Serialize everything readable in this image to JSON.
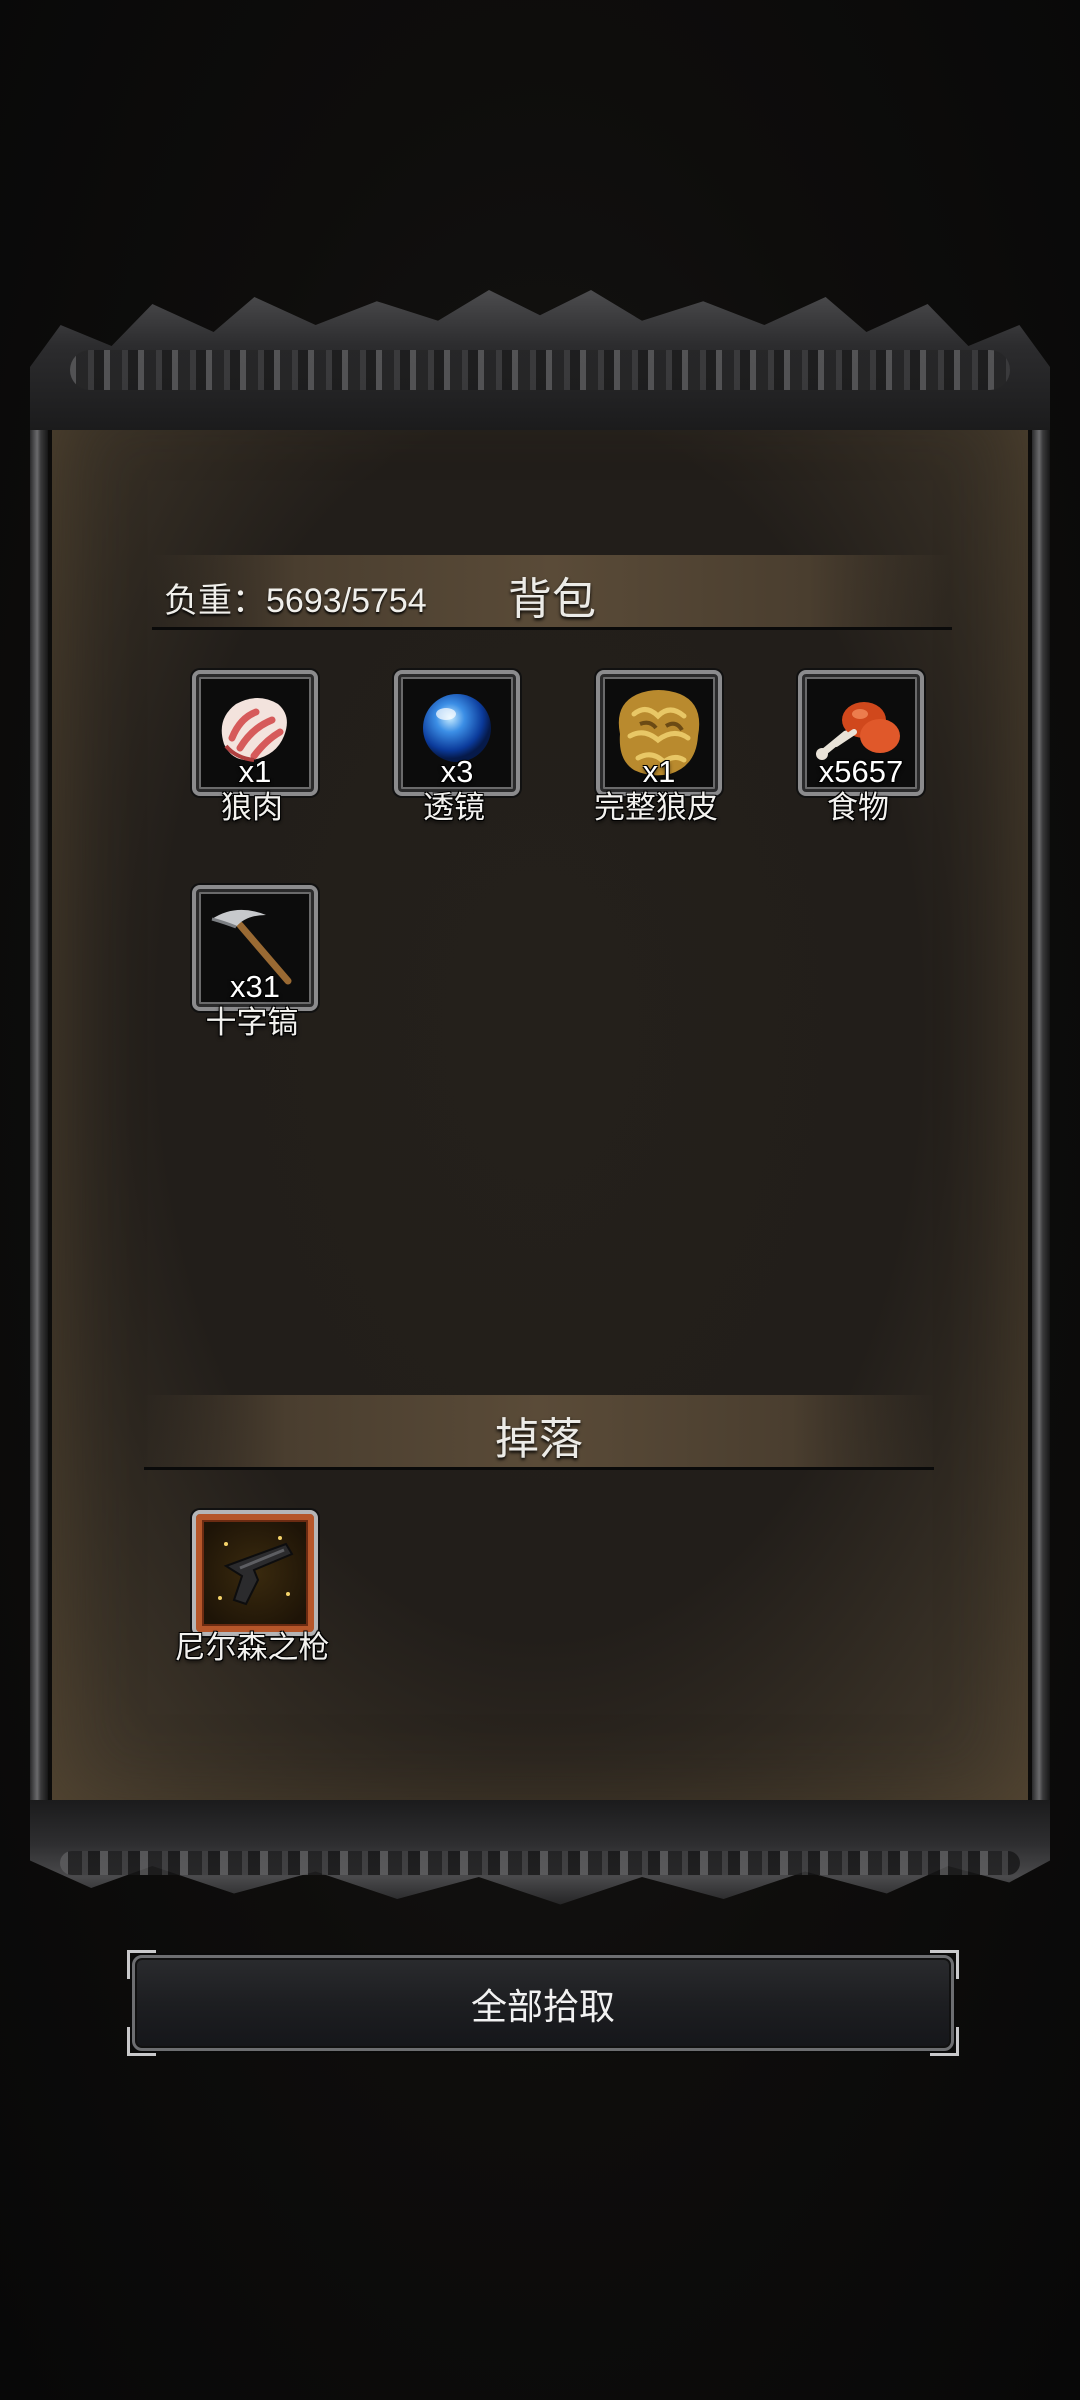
{
  "inventory": {
    "title": "背包",
    "weight_text": "负重：5693/5754",
    "items": [
      {
        "name": "狼肉",
        "count": "x1",
        "icon": "wolf-meat-icon"
      },
      {
        "name": "透镜",
        "count": "x3",
        "icon": "lens-icon"
      },
      {
        "name": "完整狼皮",
        "count": "x1",
        "icon": "wolf-pelt-icon"
      },
      {
        "name": "食物",
        "count": "x5657",
        "icon": "food-drumstick-icon"
      },
      {
        "name": "十字镐",
        "count": "x31",
        "icon": "pickaxe-icon"
      }
    ]
  },
  "drops": {
    "title": "掉落",
    "items": [
      {
        "name": "尼尔森之枪",
        "count": "",
        "icon": "gun-icon"
      }
    ]
  },
  "actions": {
    "pickup_all_label": "全部拾取"
  },
  "colors": {
    "panel": "#221e1a",
    "header_band": "#5a4b38",
    "text": "#f2f1ee",
    "rare_border": "#b5562a"
  }
}
